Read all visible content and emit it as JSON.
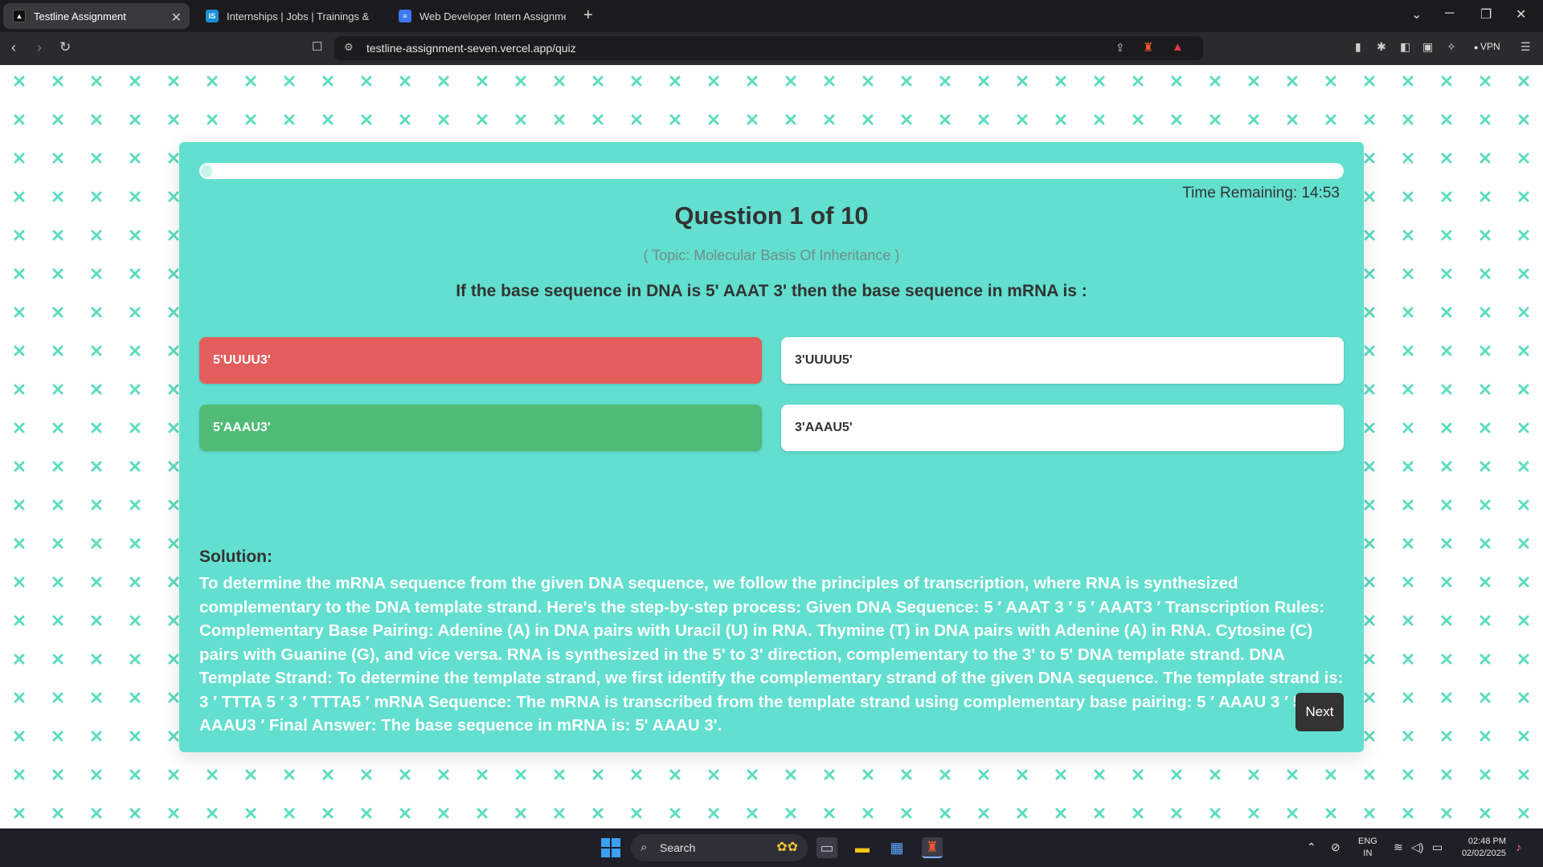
{
  "browser": {
    "tabs": [
      {
        "title": "Testline Assignment",
        "active": true,
        "favicon": "testline-icon"
      },
      {
        "title": "Internships | Jobs | Trainings & Placements",
        "active": false,
        "favicon": "internshala-icon"
      },
      {
        "title": "Web Developer Intern Assignment",
        "active": false,
        "favicon": "google-docs-icon"
      }
    ],
    "url": "testline-assignment-seven.vercel.app/quiz",
    "vpn_label": "VPN"
  },
  "quiz": {
    "progress_percent": 1,
    "time_remaining": "Time Remaining: 14:53",
    "question_title": "Question 1 of 10",
    "topic": "( Topic: Molecular Basis Of Inheritance )",
    "question_text": "If the base sequence in DNA is 5' AAAT 3' then the base sequence in mRNA is :",
    "options": [
      {
        "label": "5'UUUU3'",
        "state": "wrong"
      },
      {
        "label": "3'UUUU5'",
        "state": "neutral"
      },
      {
        "label": "5'AAAU3'",
        "state": "correct"
      },
      {
        "label": "3'AAAU5'",
        "state": "neutral"
      }
    ],
    "solution_label": "Solution:",
    "solution_text": "To determine the mRNA sequence from the given DNA sequence, we follow the principles of transcription, where RNA is synthesized complementary to the DNA template strand. Here's the step-by-step process: Given DNA Sequence: 5 ′ AAAT 3 ′ 5 ′ AAAT3 ′ Transcription Rules: Complementary Base Pairing: Adenine (A) in DNA pairs with Uracil (U) in RNA. Thymine (T) in DNA pairs with Adenine (A) in RNA. Cytosine (C) pairs with Guanine (G), and vice versa. RNA is synthesized in the 5' to 3' direction, complementary to the 3' to 5' DNA template strand. DNA Template Strand: To determine the template strand, we first identify the complementary strand of the given DNA sequence. The template strand is: 3 ′ TTTA 5 ′ 3 ′ TTTA5 ′ mRNA Sequence: The mRNA is transcribed from the template strand using complementary base pairing: 5 ′ AAAU 3 ′ 5 ′ AAAU3 ′ Final Answer: The base sequence in mRNA is: 5' AAAU 3'.",
    "next_label": "Next",
    "colors": {
      "card": "#62dfcf",
      "wrong": "#e35d5d",
      "correct": "#50bb76",
      "pattern": "#5ddcc0"
    }
  },
  "taskbar": {
    "search_placeholder": "Search",
    "language": "ENG",
    "region": "IN",
    "time": "02:48 PM",
    "date": "02/02/2025"
  }
}
